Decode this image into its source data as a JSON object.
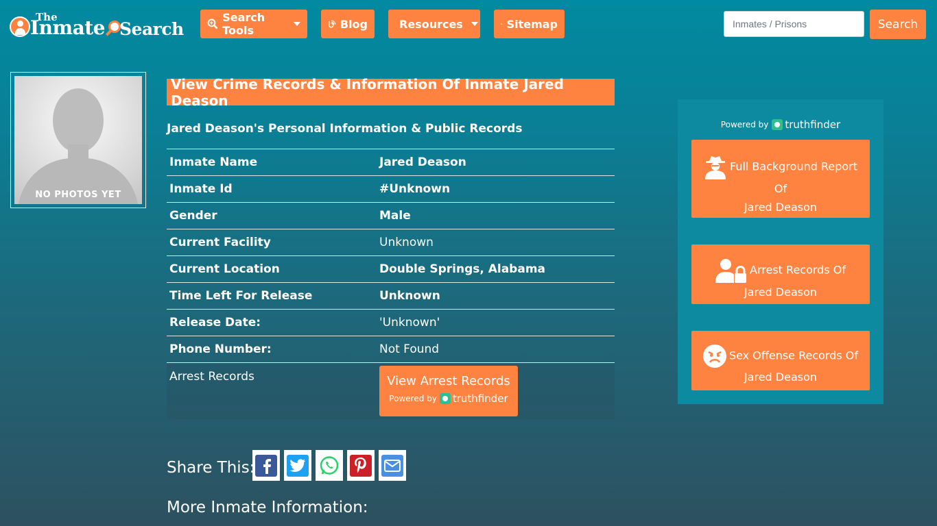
{
  "logo": {
    "the": "The",
    "inmate": "Inmate",
    "search": "Search"
  },
  "nav": {
    "search_tools": "Search Tools",
    "blog": "Blog",
    "resources": "Resources",
    "sitemap": "Sitemap"
  },
  "search": {
    "placeholder": "Inmates / Prisons",
    "button": "Search"
  },
  "photo": {
    "label": "NO PHOTOS YET"
  },
  "main": {
    "title": "View Crime Records & Information Of Inmate Jared Deason",
    "subtitle": "Jared Deason's Personal Information & Public Records"
  },
  "info": {
    "rows": [
      {
        "key": "Inmate Name",
        "value": "Jared Deason"
      },
      {
        "key": "Inmate Id",
        "value": "#Unknown"
      },
      {
        "key": "Gender",
        "value": "Male"
      },
      {
        "key": "Current Facility",
        "value": "Unknown"
      },
      {
        "key": "Current Location",
        "value": "Double Springs, Alabama"
      },
      {
        "key": "Time Left For Release",
        "value": "Unknown"
      },
      {
        "key": "Release Date:",
        "value": "'Unknown'"
      },
      {
        "key": "Phone Number:",
        "value": "Not Found"
      }
    ],
    "arrest_key": "Arrest Records",
    "arrest_button": "View Arrest Records",
    "powered_by": "Powered by",
    "truthfinder": "truthfinder"
  },
  "share": {
    "label": "Share This:"
  },
  "more_info": "More Inmate Information:",
  "sidebar": {
    "powered_by": "Powered by",
    "truthfinder": "truthfinder",
    "bg_report": [
      "Full Background Report",
      "Of",
      "Jared Deason"
    ],
    "arrest": [
      "Arrest Records Of",
      "Jared Deason"
    ],
    "sex_offense": [
      "Sex Offense Records Of",
      "Jared Deason"
    ]
  },
  "colors": {
    "accent": "#ff8340",
    "sidebar_bg": "#0d8aa0",
    "facebook": "#3b5998",
    "twitter": "#1da1f2",
    "whatsapp": "#25d366",
    "pinterest": "#cb2027",
    "email": "#4a90e2"
  }
}
